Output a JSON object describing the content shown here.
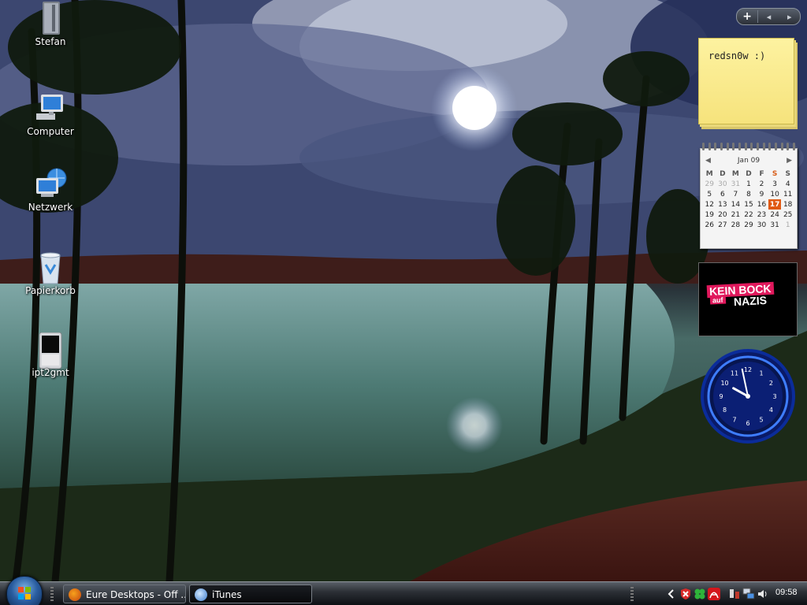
{
  "desktop": {
    "icons": [
      {
        "label": "Stefan"
      },
      {
        "label": "Computer"
      },
      {
        "label": "Netzwerk"
      },
      {
        "label": "Papierkorb"
      },
      {
        "label": "ipt2gmt"
      }
    ]
  },
  "sidebar": {
    "controls": {
      "add": "+",
      "prev": "◂",
      "next": "▸"
    },
    "note": {
      "text": "redsn0w :)"
    },
    "calendar": {
      "month_label": "Jan 09",
      "day_headers": [
        "M",
        "D",
        "M",
        "D",
        "F",
        "S",
        "S"
      ],
      "weeks": [
        [
          "29",
          "30",
          "31",
          "1",
          "2",
          "3",
          "4"
        ],
        [
          "5",
          "6",
          "7",
          "8",
          "9",
          "10",
          "11"
        ],
        [
          "12",
          "13",
          "14",
          "15",
          "16",
          "17",
          "18"
        ],
        [
          "19",
          "20",
          "21",
          "22",
          "23",
          "24",
          "25"
        ],
        [
          "26",
          "27",
          "28",
          "29",
          "30",
          "31",
          "1"
        ]
      ],
      "today": "17",
      "accent": "#e05a14"
    },
    "badge": {
      "line1": "KEIN BOCK",
      "line2": "auf",
      "line3": "NAZIS",
      "accent": "#e0185c"
    },
    "clock": {
      "time": "09:58",
      "numbers": [
        "12",
        "1",
        "2",
        "3",
        "4",
        "5",
        "6",
        "7",
        "8",
        "9",
        "10",
        "11"
      ],
      "accent": "#1e5dff"
    }
  },
  "taskbar": {
    "start_icon": "windows-orb-icon",
    "buttons": [
      {
        "label": "Eure Desktops - Off ...",
        "icon": "firefox-icon",
        "active": false
      },
      {
        "label": "iTunes",
        "icon": "itunes-icon",
        "active": true
      }
    ],
    "tray": {
      "icons": [
        "show-hidden-icons-chevron",
        "security-shield-icon",
        "clover-icon",
        "adobe-icon",
        "safely-remove-hardware-icon",
        "network-icon",
        "volume-icon"
      ],
      "time": "09:58"
    }
  }
}
